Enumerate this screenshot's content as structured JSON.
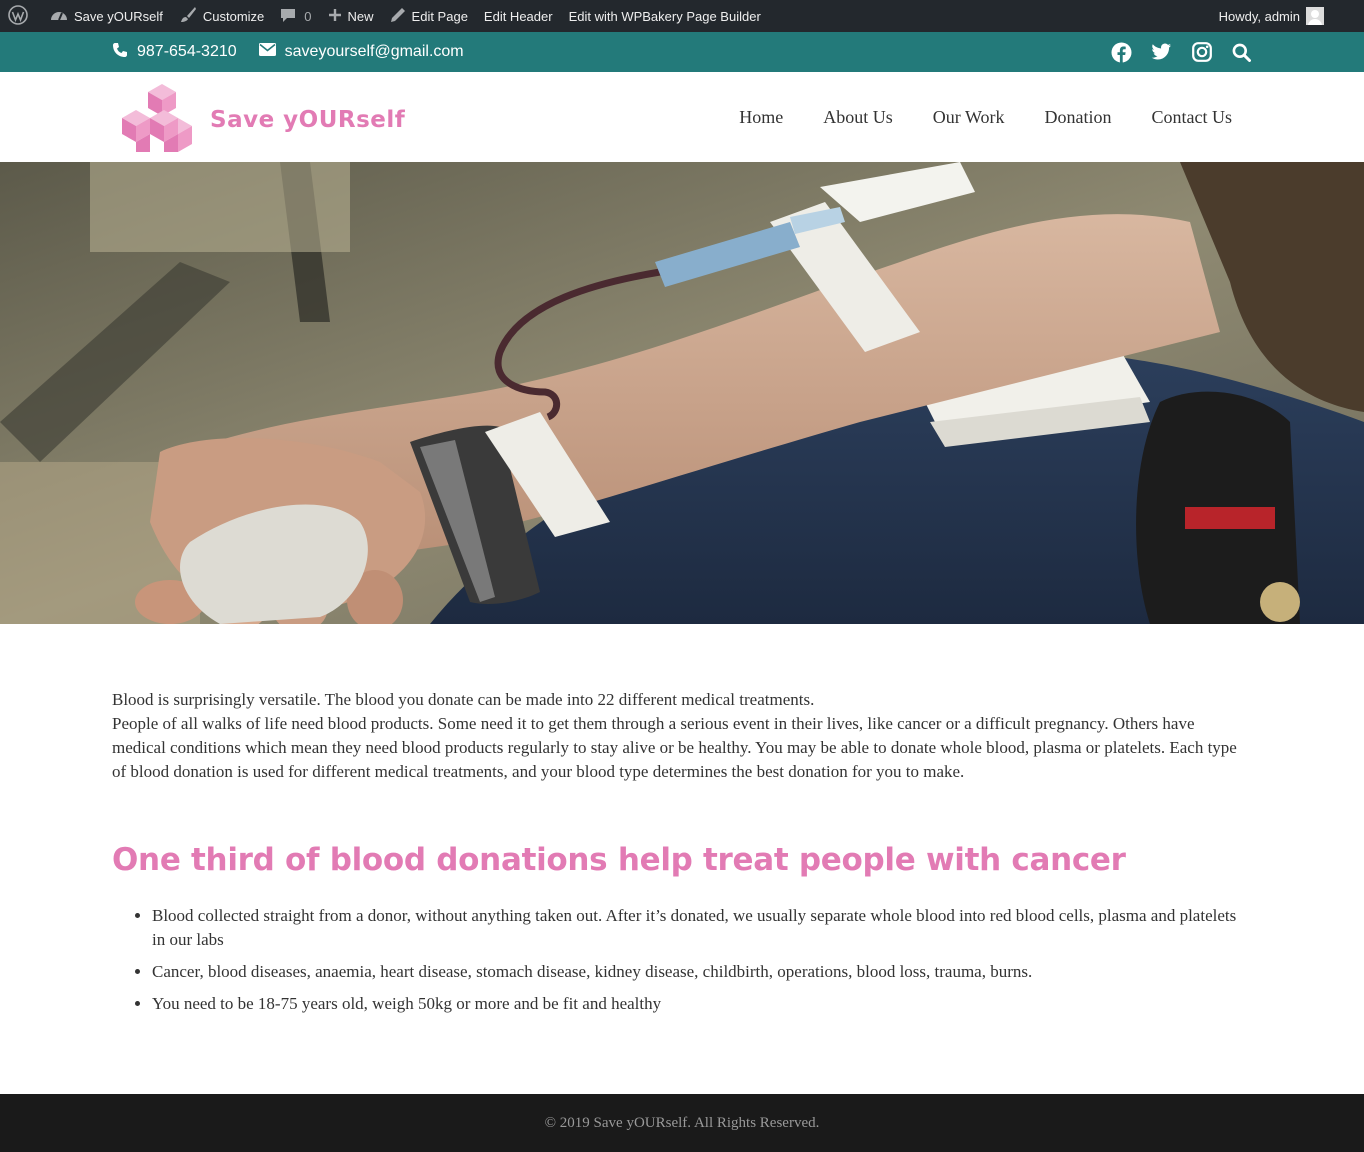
{
  "admin_bar": {
    "site_name": "Save yOURself",
    "customize": "Customize",
    "comments_count": "0",
    "new": "New",
    "edit_page": "Edit Page",
    "edit_header": "Edit Header",
    "edit_wpbakery": "Edit with WPBakery Page Builder",
    "greeting": "Howdy, admin"
  },
  "topbar": {
    "phone": "987-654-3210",
    "email": "saveyourself@gmail.com",
    "social_icons": [
      "facebook-icon",
      "twitter-icon",
      "instagram-icon",
      "search-icon"
    ]
  },
  "header": {
    "logo_text": "Save yOURself",
    "nav": [
      "Home",
      "About Us",
      "Our Work",
      "Donation",
      "Contact Us"
    ]
  },
  "content": {
    "intro_line": "Blood is surprisingly versatile. The blood you donate can be made into 22 different medical treatments.",
    "intro_para": "People of all walks of life need blood products. Some need it to get them through a serious event in their lives, like cancer or a difficult pregnancy. Others have medical conditions which mean they need blood products regularly to stay alive or be healthy. You may be able to donate whole blood, plasma or platelets. Each type of blood donation is used for different medical treatments, and your blood type determines the best donation for you to make.",
    "heading": "One third of blood donations help treat people with cancer",
    "bullets": [
      "Blood collected straight from a donor, without anything taken out. After it’s donated, we usually separate whole blood into red blood cells, plasma and platelets in our labs",
      "Cancer, blood diseases, anaemia, heart disease, stomach disease, kidney disease, childbirth, operations, blood loss, trauma, burns.",
      "You need to be 18-75 years old, weigh 50kg or more and be fit and healthy"
    ]
  },
  "footer": {
    "copyright": "© 2019 Save yOURself. All Rights Reserved."
  },
  "colors": {
    "admin_bar": "#23282d",
    "topbar": "#237a7a",
    "accent_pink": "#e27bb4",
    "footer": "#1a1a1a"
  }
}
